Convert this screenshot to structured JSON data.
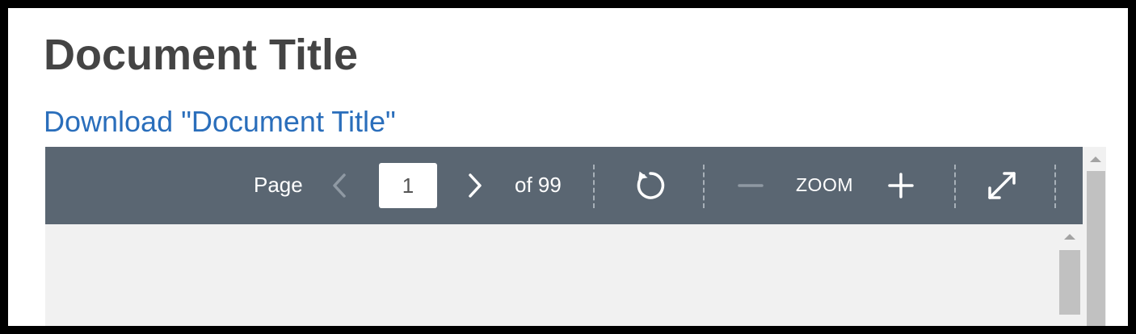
{
  "page": {
    "title": "Document Title",
    "download_link": "Download \"Document Title\""
  },
  "viewer": {
    "toolbar": {
      "page_label": "Page",
      "current_page": "1",
      "of_label": "of 99",
      "zoom_label": "ZOOM",
      "icons": {
        "previous": "chevron-left-icon",
        "next": "chevron-right-icon",
        "rotate": "rotate-icon",
        "zoom_out": "minus-icon",
        "zoom_in": "plus-icon",
        "fullscreen": "expand-icon"
      }
    }
  },
  "colors": {
    "title": "#444444",
    "link": "#2a6ebb",
    "toolbar_bg": "#5a6672",
    "viewer_bg": "#f1f1f1",
    "disabled_icon": "#8f99a3"
  }
}
